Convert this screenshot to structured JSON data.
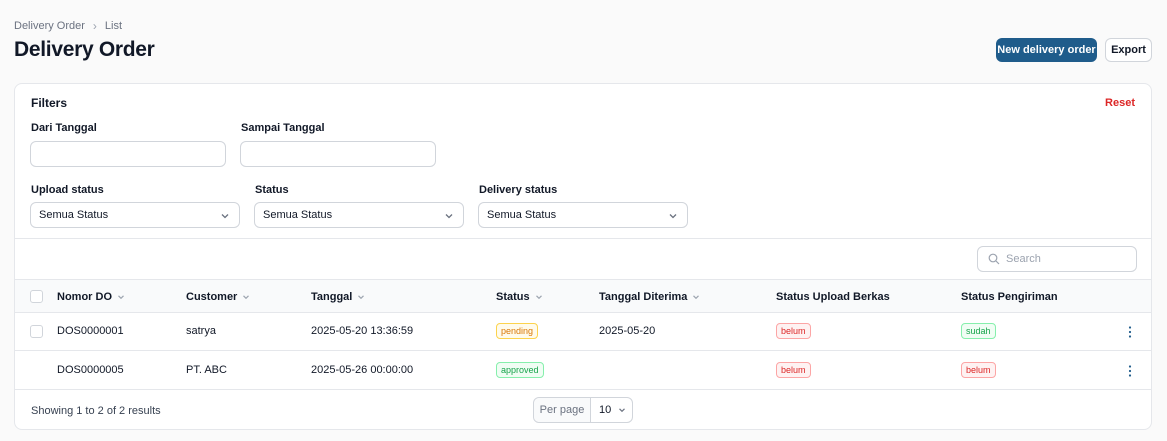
{
  "breadcrumb": {
    "parent": "Delivery Order",
    "current": "List"
  },
  "page": {
    "title": "Delivery Order"
  },
  "actions": {
    "new_label": "New delivery order",
    "export_label": "Export"
  },
  "filters": {
    "title": "Filters",
    "reset_label": "Reset",
    "date_from_label": "Dari Tanggal",
    "date_to_label": "Sampai Tanggal",
    "upload_status_label": "Upload status",
    "upload_status_value": "Semua Status",
    "status_label": "Status",
    "status_value": "Semua Status",
    "delivery_status_label": "Delivery status",
    "delivery_status_value": "Semua Status"
  },
  "search": {
    "placeholder": "Search"
  },
  "table": {
    "columns": {
      "nomor_do": "Nomor DO",
      "customer": "Customer",
      "tanggal": "Tanggal",
      "status": "Status",
      "tanggal_diterima": "Tanggal Diterima",
      "status_upload": "Status Upload Berkas",
      "status_pengiriman": "Status Pengiriman"
    },
    "rows": [
      {
        "nomor_do": "DOS0000001",
        "customer": "satrya",
        "tanggal": "2025-05-20 13:36:59",
        "status": "pending",
        "tanggal_diterima": "2025-05-20",
        "status_upload": "belum",
        "status_pengiriman": "sudah"
      },
      {
        "nomor_do": "DOS0000005",
        "customer": "PT. ABC",
        "tanggal": "2025-05-26 00:00:00",
        "status": "approved",
        "tanggal_diterima": "",
        "status_upload": "belum",
        "status_pengiriman": "belum"
      }
    ]
  },
  "footer": {
    "summary": "Showing 1 to 2 of 2 results",
    "per_page_label": "Per page",
    "per_page_value": "10"
  },
  "colors": {
    "primary": "#1f5c8b",
    "danger": "#dc2626",
    "success": "#16a34a",
    "warning": "#d97706"
  }
}
